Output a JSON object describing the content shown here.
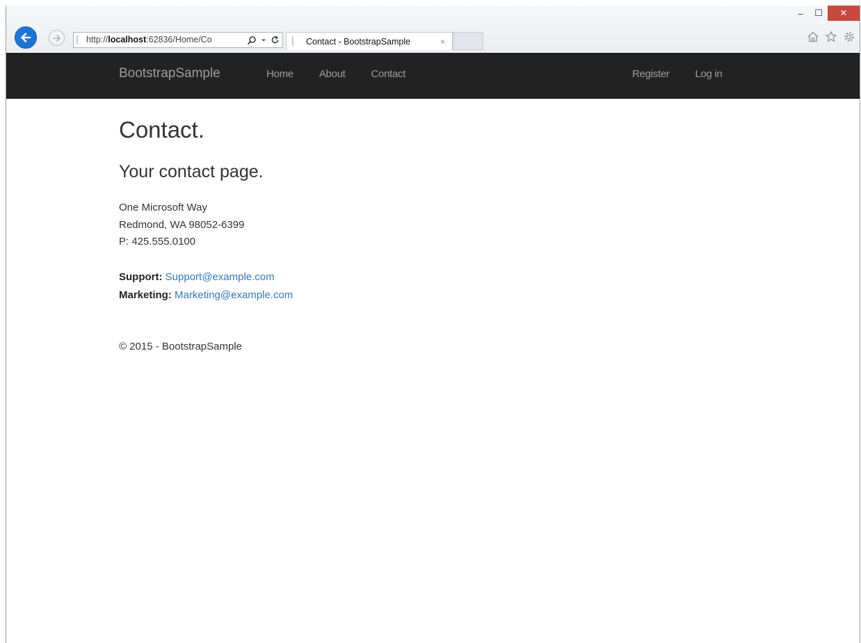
{
  "browser": {
    "address_prefix": "http://",
    "address_host": "localhost",
    "address_rest": ":62836/Home/Co",
    "tab_title": "Contact - BootstrapSample",
    "tab_close": "×",
    "win_min": "–",
    "win_max": "☐",
    "win_close": "✕"
  },
  "navbar": {
    "brand": "BootstrapSample",
    "left_items": [
      "Home",
      "About",
      "Contact"
    ],
    "right_items": [
      "Register",
      "Log in"
    ]
  },
  "page": {
    "title": "Contact.",
    "subtitle": "Your contact page.",
    "address_line1": "One Microsoft Way",
    "address_line2": "Redmond, WA 98052-6399",
    "address_line3": "P: 425.555.0100",
    "support_label": "Support:",
    "support_email": "Support@example.com",
    "marketing_label": "Marketing:",
    "marketing_email": "Marketing@example.com",
    "footer": "© 2015 - BootstrapSample"
  },
  "colors": {
    "navbar_bg": "#222222",
    "navbar_text": "#9d9d9d",
    "link": "#337ab7",
    "back_button": "#1e74d6",
    "close_button": "#c7493f"
  },
  "icons": [
    "back-arrow-icon",
    "forward-arrow-icon",
    "search-icon",
    "dropdown-icon",
    "refresh-icon",
    "home-icon",
    "favorites-star-icon",
    "settings-gear-icon"
  ]
}
